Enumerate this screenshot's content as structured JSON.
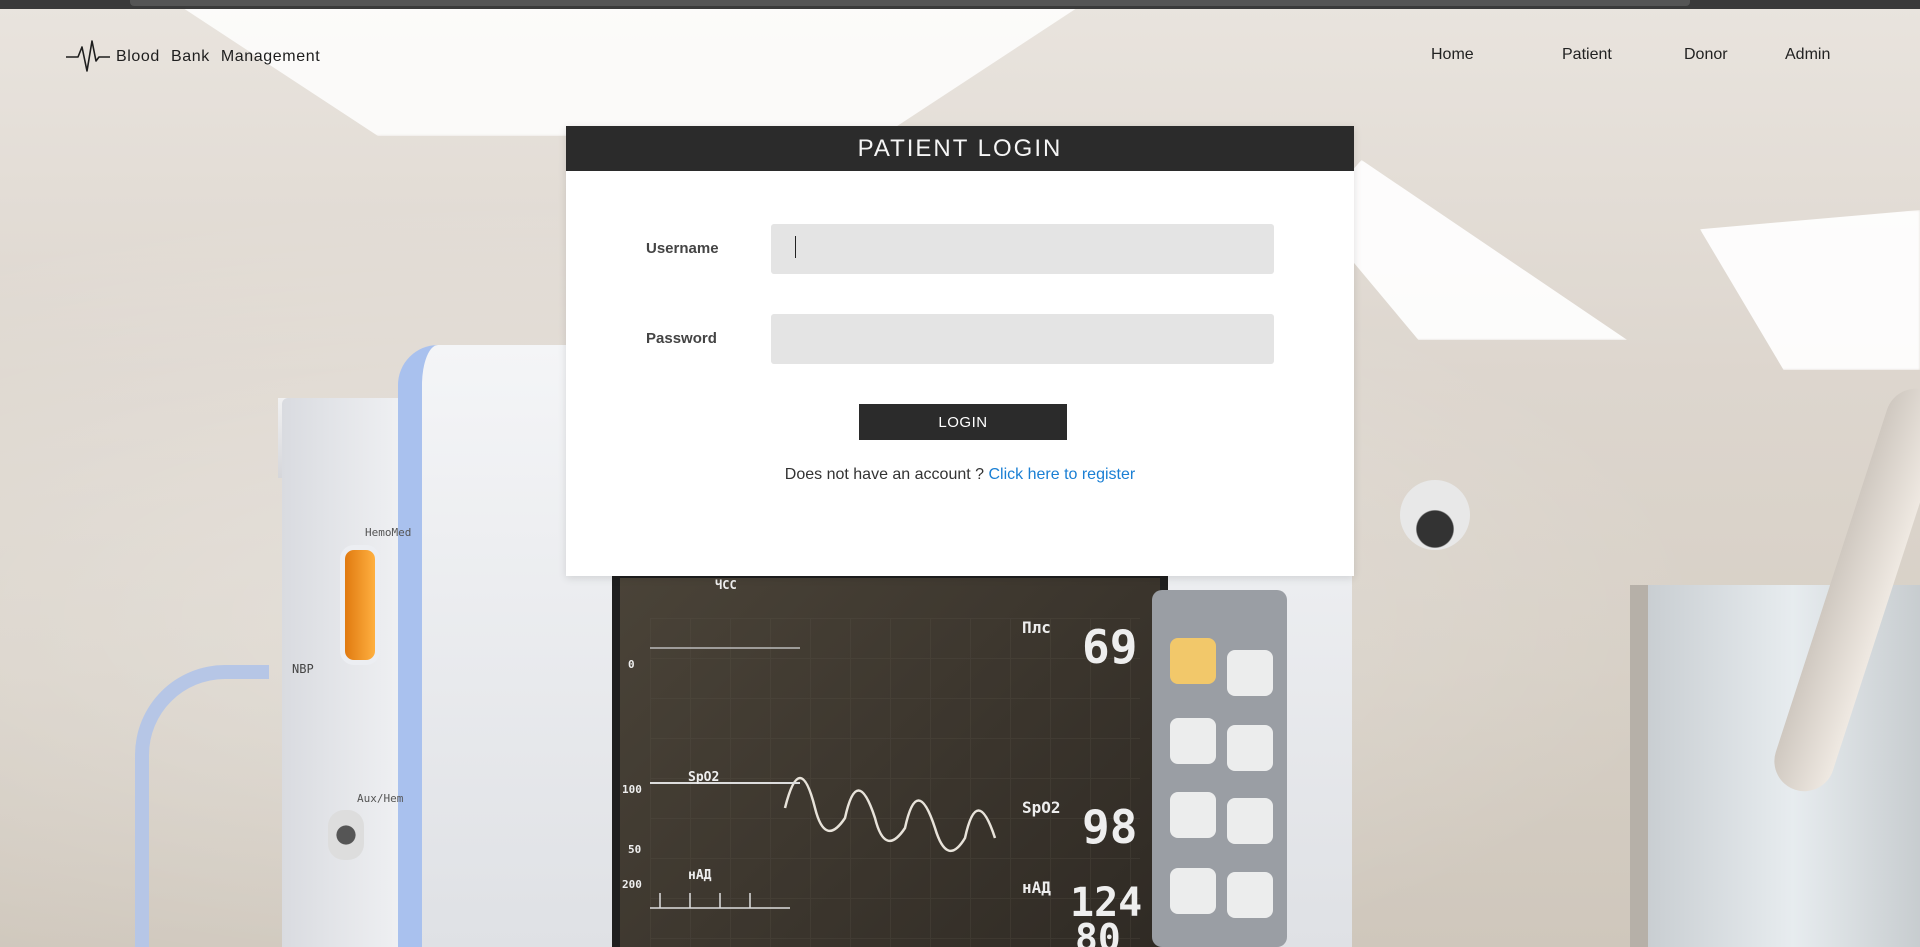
{
  "brand": {
    "name": "Blood Bank Management",
    "logo_icon": "heartbeat-icon"
  },
  "nav": {
    "items": [
      {
        "label": "Home"
      },
      {
        "label": "Patient"
      },
      {
        "label": "Donor"
      },
      {
        "label": "Admin"
      }
    ]
  },
  "login": {
    "title": "PATIENT LOGIN",
    "username_label": "Username",
    "username_value": "",
    "password_label": "Password",
    "password_value": "",
    "button_label": "LOGIN",
    "register_prompt": "Does not have an account ?",
    "register_link": "Click here to register"
  },
  "colors": {
    "header_bg": "#2b2b2b",
    "button_bg": "#2b2b2b",
    "link": "#1a7fd4",
    "input_bg": "#e4e4e4"
  },
  "background_display": {
    "text": [
      "HemoMed",
      "NBP",
      "Aux/Hem",
      "ЧСС",
      "SpO2",
      "нАД",
      "Плс",
      "69",
      "98",
      "124",
      "80",
      "100",
      "50",
      "0",
      "200"
    ]
  }
}
